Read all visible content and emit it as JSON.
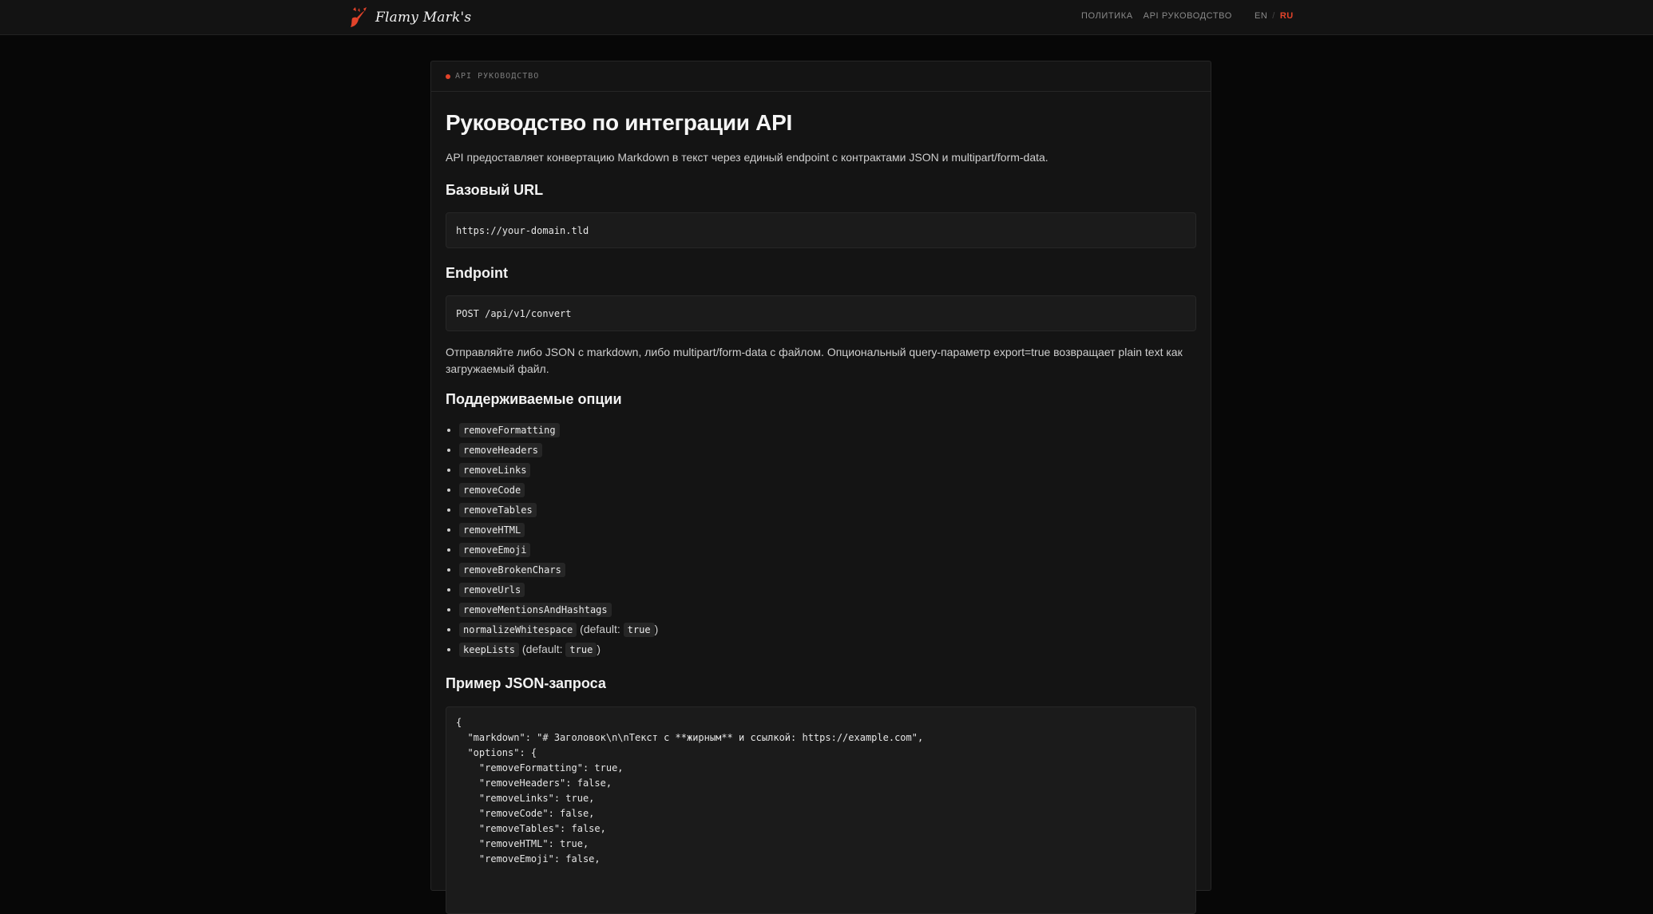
{
  "colors": {
    "accent": "#e2432a",
    "background": "#070707",
    "card": "#141414",
    "code_bg": "#1b1b1b"
  },
  "header": {
    "logo_icon": "flame-brush-icon",
    "brand": "Flamy Mark's",
    "nav": [
      "ПОЛИТИКА",
      "API РУКОВОДСТВО"
    ],
    "lang": {
      "en": "EN",
      "separator": "/",
      "ru": "RU",
      "active": "RU"
    }
  },
  "doc": {
    "kicker": "API РУКОВОДСТВО",
    "title": "Руководство по интеграции API",
    "intro": "API предоставляет конвертацию Markdown в текст через единый endpoint с контрактами JSON и multipart/form-data.",
    "base_url_heading": "Базовый URL",
    "base_url": "https://your-domain.tld",
    "endpoint_heading": "Endpoint",
    "endpoint": "POST /api/v1/convert",
    "endpoint_desc": "Отправляйте либо JSON с markdown, либо multipart/form-data с файлом. Опциональный query-параметр export=true возвращает plain text как загружаемый файл.",
    "options_heading": "Поддерживаемые опции",
    "options": [
      {
        "name": "removeFormatting"
      },
      {
        "name": "removeHeaders"
      },
      {
        "name": "removeLinks"
      },
      {
        "name": "removeCode"
      },
      {
        "name": "removeTables"
      },
      {
        "name": "removeHTML"
      },
      {
        "name": "removeEmoji"
      },
      {
        "name": "removeBrokenChars"
      },
      {
        "name": "removeUrls"
      },
      {
        "name": "removeMentionsAndHashtags"
      },
      {
        "name": "normalizeWhitespace",
        "default_prefix": "(default:",
        "default_value": "true",
        "default_suffix": ")"
      },
      {
        "name": "keepLists",
        "default_prefix": "(default:",
        "default_value": "true",
        "default_suffix": ")"
      }
    ],
    "example_heading": "Пример JSON-запроса",
    "example_code": "{\n  \"markdown\": \"# Заголовок\\n\\nТекст с **жирным** и ссылкой: https://example.com\",\n  \"options\": {\n    \"removeFormatting\": true,\n    \"removeHeaders\": false,\n    \"removeLinks\": true,\n    \"removeCode\": false,\n    \"removeTables\": false,\n    \"removeHTML\": true,\n    \"removeEmoji\": false,"
  }
}
